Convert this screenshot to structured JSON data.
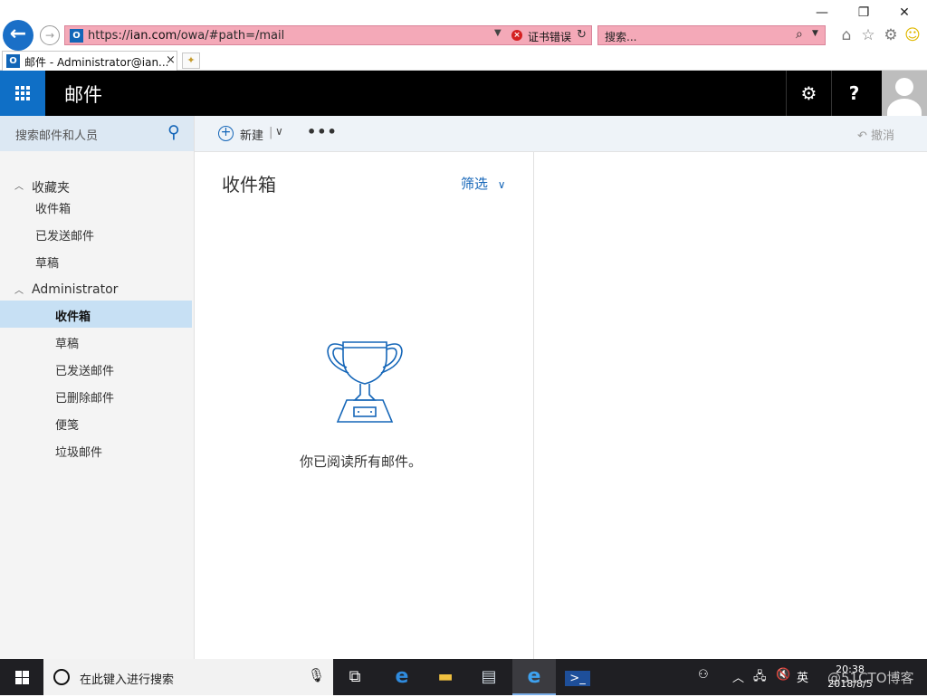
{
  "browser": {
    "address": {
      "prefix": "https://",
      "host": "ian.com",
      "path": "/owa/#path=/mail",
      "cert_error": "证书错误"
    },
    "search_placeholder": "搜索...",
    "tab": {
      "title": "邮件 - Administrator@ian...",
      "close": "×"
    },
    "favicon_letter": "O",
    "window": {
      "minimize": "—",
      "restore": "❐",
      "close": "✕"
    },
    "toolbar_icons": [
      "home-icon",
      "favorites-star-icon",
      "tools-gear-icon",
      "feedback-smiley-icon"
    ]
  },
  "owa": {
    "app_title": "邮件",
    "settings_glyph": "⚙",
    "help_glyph": "?",
    "search_placeholder": "搜索邮件和人员",
    "commands": {
      "new": "新建",
      "more": "•••",
      "undo": "撤消"
    },
    "nav": {
      "favorites": {
        "label": "收藏夹",
        "items": [
          "收件箱",
          "已发送邮件",
          "草稿"
        ]
      },
      "account": {
        "label": "Administrator",
        "items": [
          "收件箱",
          "草稿",
          "已发送邮件",
          "已删除邮件",
          "便笺",
          "垃圾邮件"
        ],
        "selected_index": 0
      }
    },
    "list": {
      "folder_title": "收件箱",
      "filter_label": "筛选",
      "empty_message": "你已阅读所有邮件。"
    }
  },
  "taskbar": {
    "search_placeholder": "在此键入进行搜索",
    "ime": "英",
    "time": "20:38",
    "date": "2018/8/5",
    "watermark": "@51CTO博客"
  }
}
